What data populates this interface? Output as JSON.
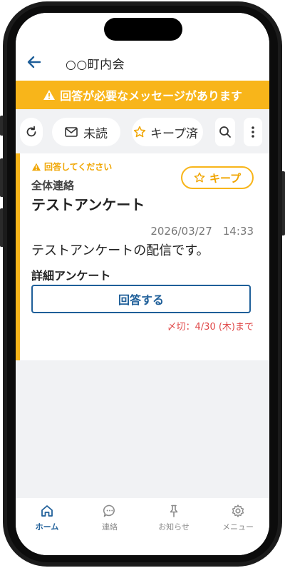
{
  "header": {
    "title": "○○町内会"
  },
  "banner": {
    "text": "回答が必要なメッセージがあります"
  },
  "toolbar": {
    "unread_label": "未読",
    "kept_label": "キープ済"
  },
  "message": {
    "needs_answer": "回答してください",
    "keep_label": "キープ",
    "category": "全体連絡",
    "title": "テストアンケート",
    "datetime": "2026/03/27　14:33",
    "body": "テストアンケートの配信です。",
    "survey_label": "詳細アンケート",
    "answer_button": "回答する",
    "deadline": "〆切：4/30 (木)まで"
  },
  "tabs": [
    {
      "label": "ホーム",
      "icon": "home-icon",
      "active": true
    },
    {
      "label": "連絡",
      "icon": "chat-icon",
      "active": false
    },
    {
      "label": "お知らせ",
      "icon": "pin-icon",
      "active": false
    },
    {
      "label": "メニュー",
      "icon": "gear-icon",
      "active": false
    }
  ],
  "colors": {
    "accent": "#f8b51a",
    "primary": "#1f5f99",
    "deadline": "#e04848"
  }
}
